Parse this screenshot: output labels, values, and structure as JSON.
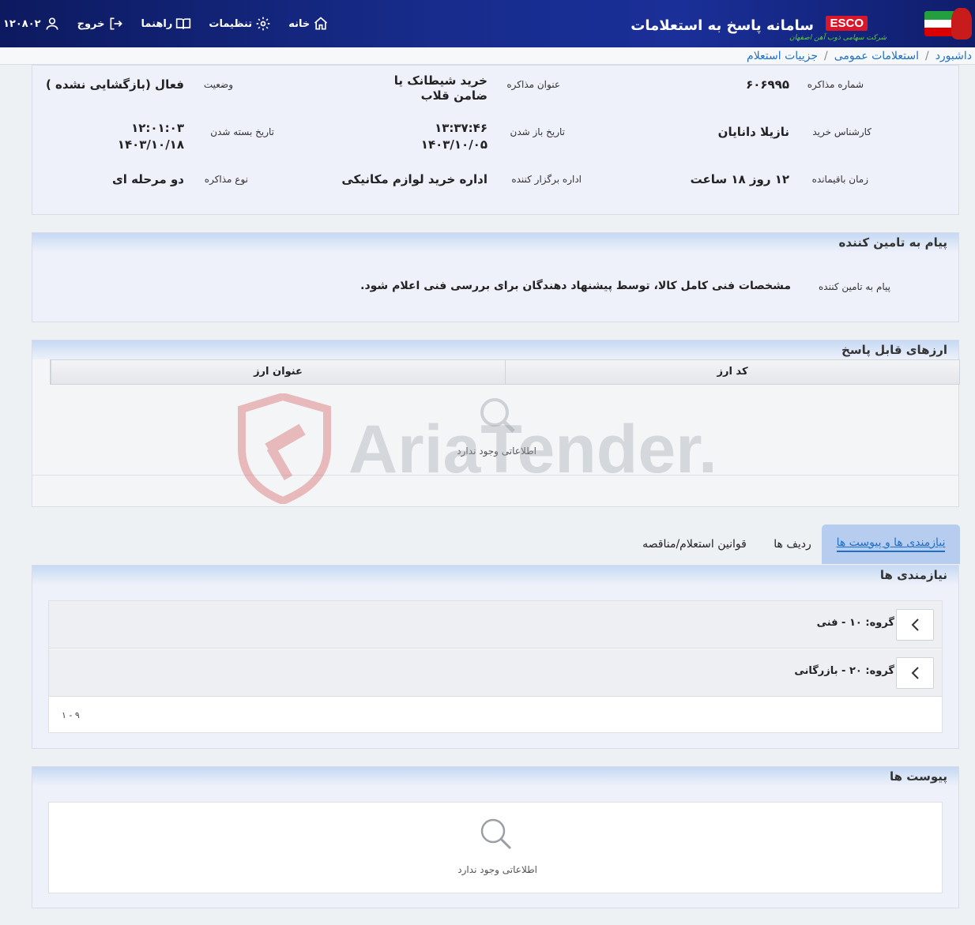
{
  "header": {
    "app_title": "سامانه پاسخ به استعلامات",
    "logo_text": "ESCO",
    "logo_subtitle": "شرکت سهامی ذوب آهن اصفهان",
    "nav": {
      "home": "خانه",
      "settings": "تنظیمات",
      "help": "راهنما",
      "logout": "خروج",
      "user_id": "۱۲۰۸۰۲"
    }
  },
  "breadcrumb": [
    "داشبورد",
    "استعلامات عمومی",
    "جزییات استعلام"
  ],
  "details": {
    "number_label": "شماره مذاکره",
    "number_value": "۶۰۶۹۹۵",
    "title_label": "عنوان مذاکره",
    "title_value": "خرید شیطانک یا ضامن قلاب",
    "status_label": "وضعیت",
    "status_value": "فعال (بازگشایی نشده )",
    "expert_label": "کارشناس خرید",
    "expert_value": "نازیلا دانایان",
    "open_label": "تاریخ باز شدن",
    "open_time": "۱۳:۳۷:۴۶",
    "open_date": "۱۴۰۳/۱۰/۰۵",
    "close_label": "تاریخ بسته شدن",
    "close_time": "۱۲:۰۱:۰۳",
    "close_date": "۱۴۰۳/۱۰/۱۸",
    "remaining_label": "زمان باقیمانده",
    "remaining_value": "۱۲ روز ۱۸ ساعت",
    "org_label": "اداره برگزار کننده",
    "org_value": "اداره خرید لوازم مکانیکی",
    "type_label": "نوع مذاکره",
    "type_value": "دو مرحله ای"
  },
  "supplier_message": {
    "section_title": "پیام به تامین کننده",
    "label": "پیام به تامین کننده",
    "text": "مشخصات فنی کامل کالا، توسط پیشنهاد دهندگان برای بررسی فنی اعلام شود."
  },
  "currencies": {
    "section_title": "ارزهای قابل پاسخ",
    "columns": [
      "کد ارز",
      "عنوان ارز"
    ],
    "empty_text": "اطلاعاتی وجود ندارد"
  },
  "tabs": [
    {
      "label": "نیازمندی ها و پیوست ها",
      "active": true
    },
    {
      "label": "ردیف ها",
      "active": false
    },
    {
      "label": "قوانین استعلام/مناقصه",
      "active": false
    }
  ],
  "requirements": {
    "section_title": "نیازمندی ها",
    "groups": [
      {
        "label": "گروه: ۱۰ - فنی"
      },
      {
        "label": "گروه: ۲۰ - بازرگانی"
      }
    ],
    "pagination": "۱ - ۹"
  },
  "attachments": {
    "section_title": "پیوست ها",
    "empty_text": "اطلاعاتی وجود ندارد"
  },
  "watermark": "AriaTender.neT",
  "colors": {
    "header_bg": "#172c8c",
    "link": "#1f6fc8",
    "active_tab": "#b6cdf0",
    "logo_red": "#d8172a"
  }
}
